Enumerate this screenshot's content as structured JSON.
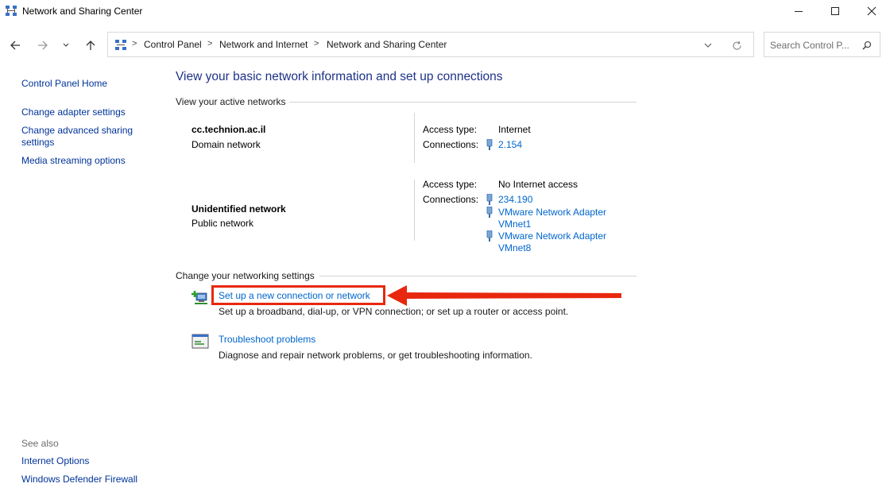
{
  "window": {
    "title": "Network and Sharing Center",
    "minimize_label": "—",
    "maximize_label": "☐",
    "close_label": "✕"
  },
  "address_bar": {
    "crumbs": [
      "Control Panel",
      "Network and Internet",
      "Network and Sharing Center"
    ],
    "separator": ">"
  },
  "search": {
    "placeholder": "Search Control P..."
  },
  "sidebar": {
    "home": "Control Panel Home",
    "adapter": "Change adapter settings",
    "advanced_line1": "Change advanced sharing",
    "advanced_line2": "settings",
    "media": "Media streaming options",
    "see_also": "See also",
    "internet_options": "Internet Options",
    "firewall": "Windows Defender Firewall"
  },
  "main": {
    "title": "View your basic network information and set up connections",
    "active_networks_header": "View your active networks",
    "networks": [
      {
        "name": "cc.technion.ac.il",
        "type": "Domain network",
        "access_type_label": "Access type:",
        "access_type": "Internet",
        "connections_label": "Connections:",
        "connections": [
          "2.154"
        ]
      },
      {
        "name": "Unidentified network",
        "type": "Public network",
        "access_type_label": "Access type:",
        "access_type": "No Internet access",
        "connections_label": "Connections:",
        "connections": [
          "234.190",
          "VMware Network Adapter",
          "VMnet1",
          "VMware Network Adapter",
          "VMnet8"
        ]
      }
    ],
    "change_settings_header": "Change your networking settings",
    "tasks": [
      {
        "link": "Set up a new connection or network",
        "desc": "Set up a broadband, dial-up, or VPN connection; or set up a router or access point."
      },
      {
        "link": "Troubleshoot problems",
        "desc": "Diagnose and repair network problems, or get troubleshooting information."
      }
    ]
  },
  "colors": {
    "link": "#0066cc",
    "highlight": "#e8280e",
    "title": "#1e3287"
  }
}
